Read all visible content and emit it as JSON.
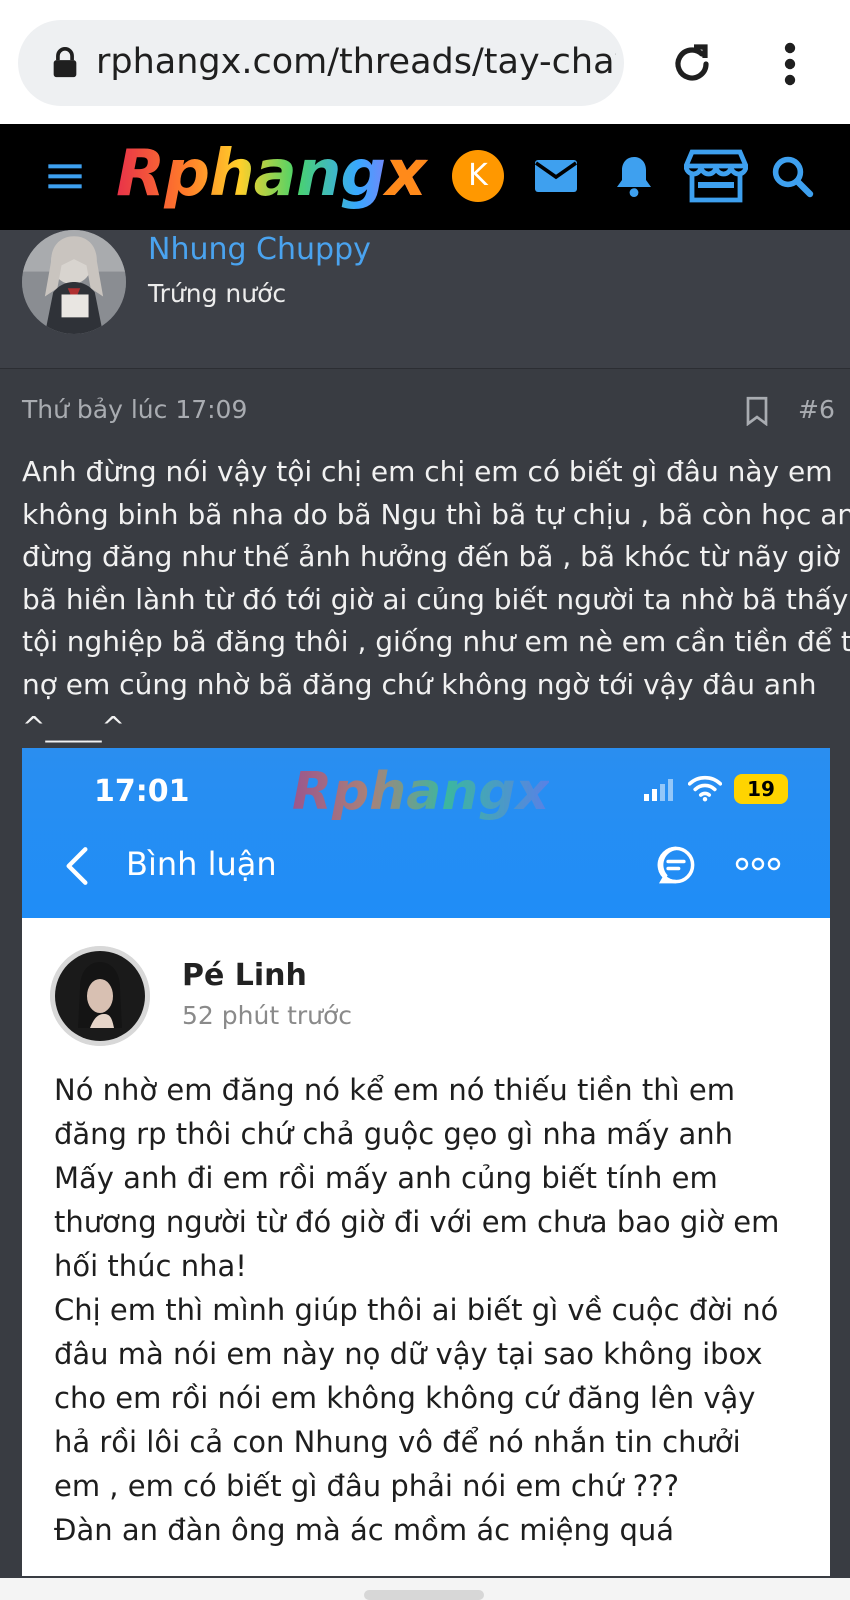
{
  "browser": {
    "url": "rphangx.com/threads/tay-chay-pe",
    "icons": [
      "lock-icon",
      "reload-icon",
      "more-vert-icon"
    ]
  },
  "site_header": {
    "logo_text": "Rphang",
    "logo_x": "x",
    "account_initial": "K",
    "accent_color": "#ff9800",
    "icon_color": "#3ea0ef",
    "icons": [
      "hamburger-icon",
      "mail-icon",
      "bell-icon",
      "store-icon",
      "search-icon"
    ]
  },
  "post": {
    "author_name": "Nhung Chuppy",
    "author_title": "Trứng nước",
    "time": "Thứ bảy lúc 17:09",
    "number": "#6",
    "body_lines": [
      "Anh đừng nói vậy tội chị em chị em có biết gì đâu này em",
      "không binh bã nha do bã Ngu thì bã tự chịu , bã còn học anh",
      "đừng đăng như thế ảnh hưởng đến bã , bã khóc từ nãy giờ á",
      "bã hiền lành từ đó tới giờ ai củng biết người ta nhờ bã thấy",
      "tội nghiệp bã đăng thôi , giống như em nè em cần tiền để trả",
      "nợ em củng nhờ bã đăng chứ không ngờ tới vậy đâu anh",
      "^____^"
    ]
  },
  "embedded_screenshot": {
    "status_time": "17:01",
    "watermark": "Rphangx",
    "battery": "19",
    "page_title": "Bình luận",
    "commenter_name": "Pé Linh",
    "comment_time": "52 phút trước",
    "comment_lines": [
      "Nó nhờ em đăng nó kể em nó thiếu tiền thì em",
      "đăng rp thôi chứ chả guộc gẹo gì nha mấy anh",
      "Mấy anh đi em rồi mấy anh củng biết tính em",
      "thương người từ đó giờ đi với em chưa bao giờ em",
      "hối thúc nha!",
      "Chị em thì mình giúp thôi ai biết gì về cuộc đời nó",
      "đâu mà nói em này nọ dữ vậy tại sao không ibox",
      "cho em rồi nói em không không cứ đăng lên vậy",
      "hả rồi lôi cả con Nhung vô để nó nhắn tin chưởi",
      "em , em có biết gì đâu phải nói em chứ ???",
      "Đàn an đàn ông mà ác mồm ác miệng quá"
    ],
    "topbar_color": "#1f8df7"
  }
}
